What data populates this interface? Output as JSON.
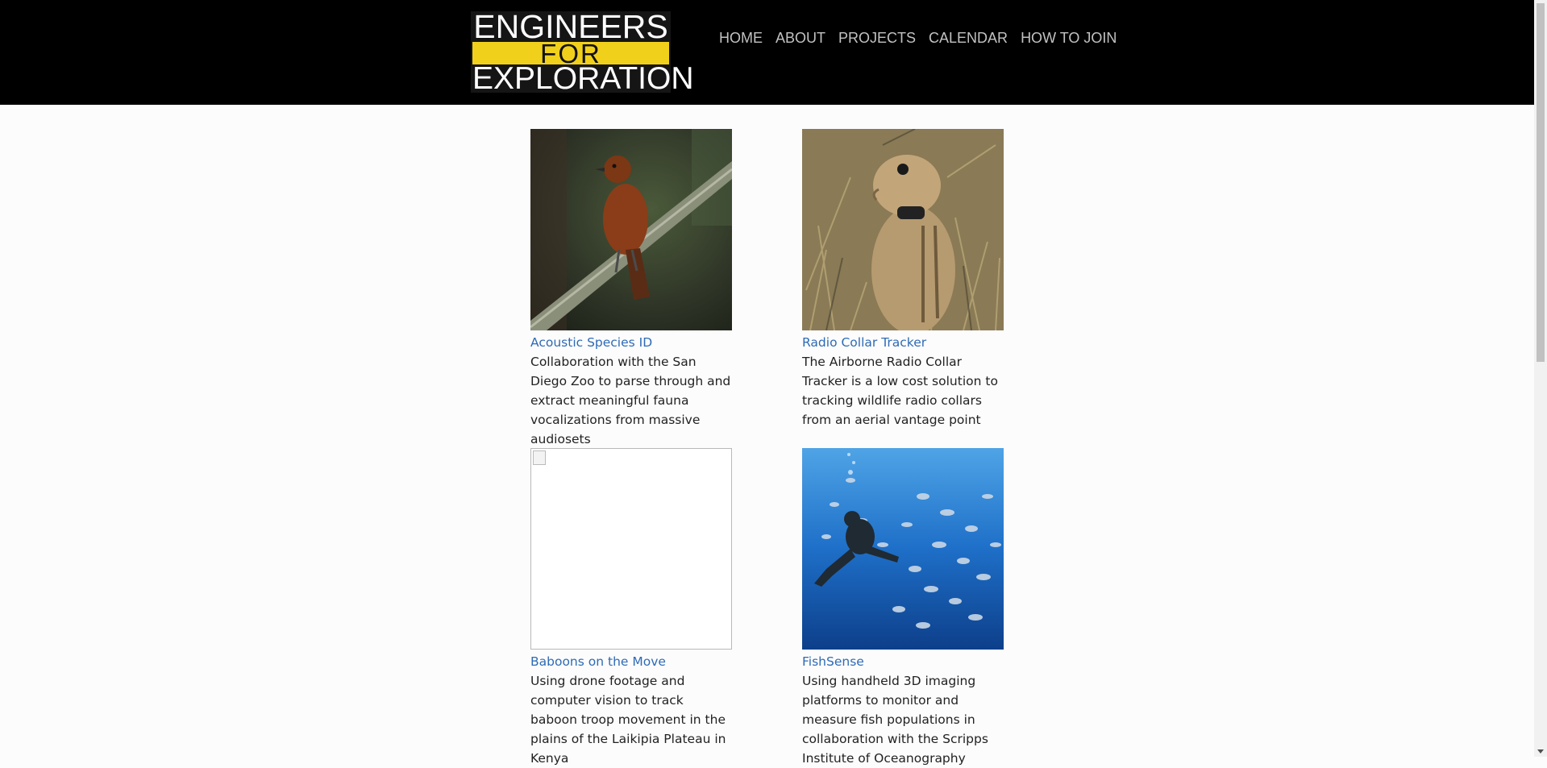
{
  "brand": {
    "logo_top": "ENGINEERS",
    "logo_mid": "FOR",
    "logo_bottom": "EXPLORATION",
    "accent_color": "#f1d01c"
  },
  "nav": {
    "items": [
      "HOME",
      "ABOUT",
      "PROJECTS",
      "CALENDAR",
      "HOW TO JOIN"
    ]
  },
  "projects": [
    {
      "title": "Acoustic Species ID",
      "description": "Collaboration with the San Diego Zoo to parse through and extract meaningful fauna vocalizations from massive audiosets",
      "image": "bird-on-branch-photo"
    },
    {
      "title": "Radio Collar Tracker",
      "description": "The Airborne Radio Collar Tracker is a low cost solution to tracking wildlife radio collars from an aerial vantage point",
      "image": "ground-squirrel-photo"
    },
    {
      "title": "Baboons on the Move",
      "description": "Using drone footage and computer vision to track baboon troop movement in the plains of the Laikipia Plateau in Kenya",
      "image": "broken-image-icon"
    },
    {
      "title": "FishSense",
      "description": "Using handheld 3D imaging platforms to monitor and measure fish populations in collaboration with the Scripps Institute of Oceanography",
      "image": "diver-with-fish-photo"
    }
  ]
}
